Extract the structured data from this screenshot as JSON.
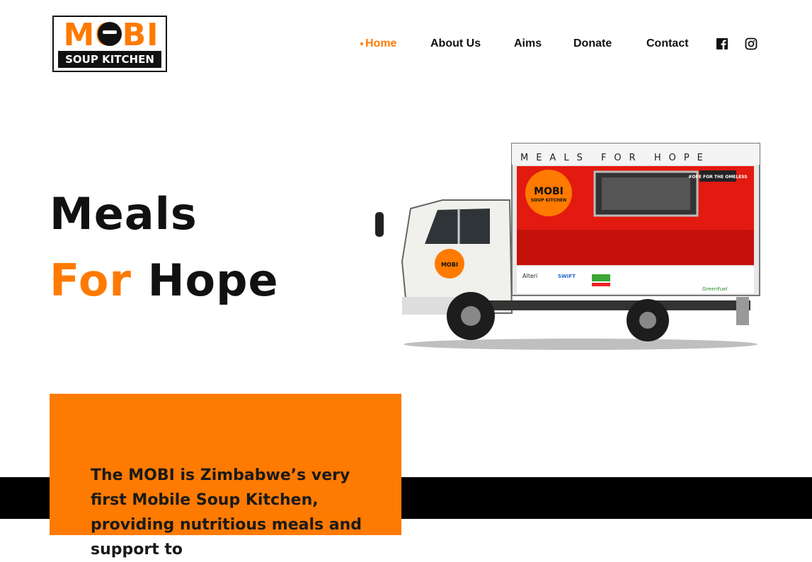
{
  "logo": {
    "title": "MOBI",
    "subtitle": "SOUP KITCHEN"
  },
  "nav": {
    "items": [
      {
        "label": "Home",
        "active": true
      },
      {
        "label": "About Us"
      },
      {
        "label": "Aims"
      },
      {
        "label": "Donate"
      },
      {
        "label": "Contact"
      }
    ],
    "social": [
      "facebook-icon",
      "instagram-icon"
    ]
  },
  "hero": {
    "line1": "Meals",
    "line2_accent": "For",
    "line2_rest": "Hope"
  },
  "truck_graphic": {
    "banner": "MEALS FOR HOPE",
    "badge": "MOBI",
    "badge_sub": "SOUP KITCHEN",
    "tag": "#OPE FOR THE OMELESS",
    "sponsors": [
      "Alteri",
      "SWIFT",
      "GreenFuel"
    ]
  },
  "card": {
    "text": "The MOBI is Zimbabwe’s very first Mobile Soup Kitchen, providing nutritious meals and support to"
  },
  "colors": {
    "accent": "#ff7a00",
    "text": "#111111",
    "band": "#000000"
  }
}
